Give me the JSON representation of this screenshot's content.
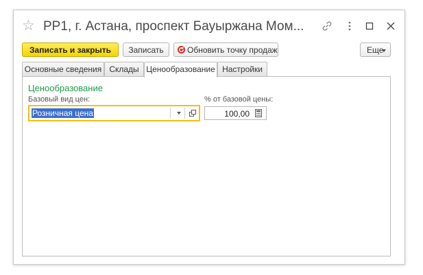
{
  "window": {
    "title": "РР1, г. Астана,  проспект Бауыржана Мом...",
    "icons": [
      "star-icon",
      "link-icon",
      "more-vert-icon",
      "maximize-icon",
      "close-icon"
    ]
  },
  "toolbar": {
    "save_close_label": "Записать и закрыть",
    "save_label": "Записать",
    "refresh_label": "Обновить точку продаж",
    "more_label": "Еще"
  },
  "tabs": [
    {
      "label": "Основные сведения",
      "active": false
    },
    {
      "label": "Склады",
      "active": false
    },
    {
      "label": "Ценообразование",
      "active": true
    },
    {
      "label": "Настройки",
      "active": false
    }
  ],
  "pricing": {
    "group_title": "Ценообразование",
    "base_price_label": "Базовый вид цен:",
    "base_price_value": "Розничная цена",
    "percent_label": "% от базовой цены:",
    "percent_value": "100,00"
  },
  "colors": {
    "primary_button": "#f5d400",
    "group_title": "#1a9c4b",
    "selection": "#3b6fd0",
    "focus_border": "#f2c10f",
    "refresh_icon": "#d9332b"
  }
}
